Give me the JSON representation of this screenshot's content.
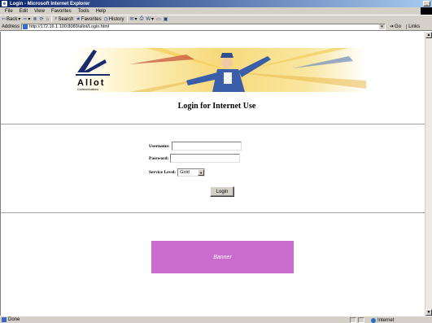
{
  "window": {
    "title": "Login - Microsoft Internet Explorer",
    "buttons": [
      "_"
    ]
  },
  "menu": [
    "File",
    "Edit",
    "View",
    "Favorites",
    "Tools",
    "Help"
  ],
  "toolbar": {
    "back": "Back",
    "search": "Search",
    "favorites": "Favorites",
    "history": "History"
  },
  "address": {
    "label": "Address",
    "url": "http://172.16.1.100:8080/allot/Login.html",
    "go": "Go",
    "links": "Links"
  },
  "logo": {
    "brand": "Allot",
    "tagline": "Communications"
  },
  "page": {
    "title": "Login for Internet Use"
  },
  "form": {
    "username_label": "Username:",
    "password_label": "Password:",
    "service_label": "Service Level:",
    "service_value": "Gold",
    "login_button": "Login"
  },
  "ad": {
    "label": "Banner",
    "color": "#c96ccd"
  },
  "status": {
    "text": "Done",
    "zone": "Internet"
  },
  "colors": {
    "titlebar_start": "#0a246a",
    "chrome": "#d4d0c8"
  }
}
